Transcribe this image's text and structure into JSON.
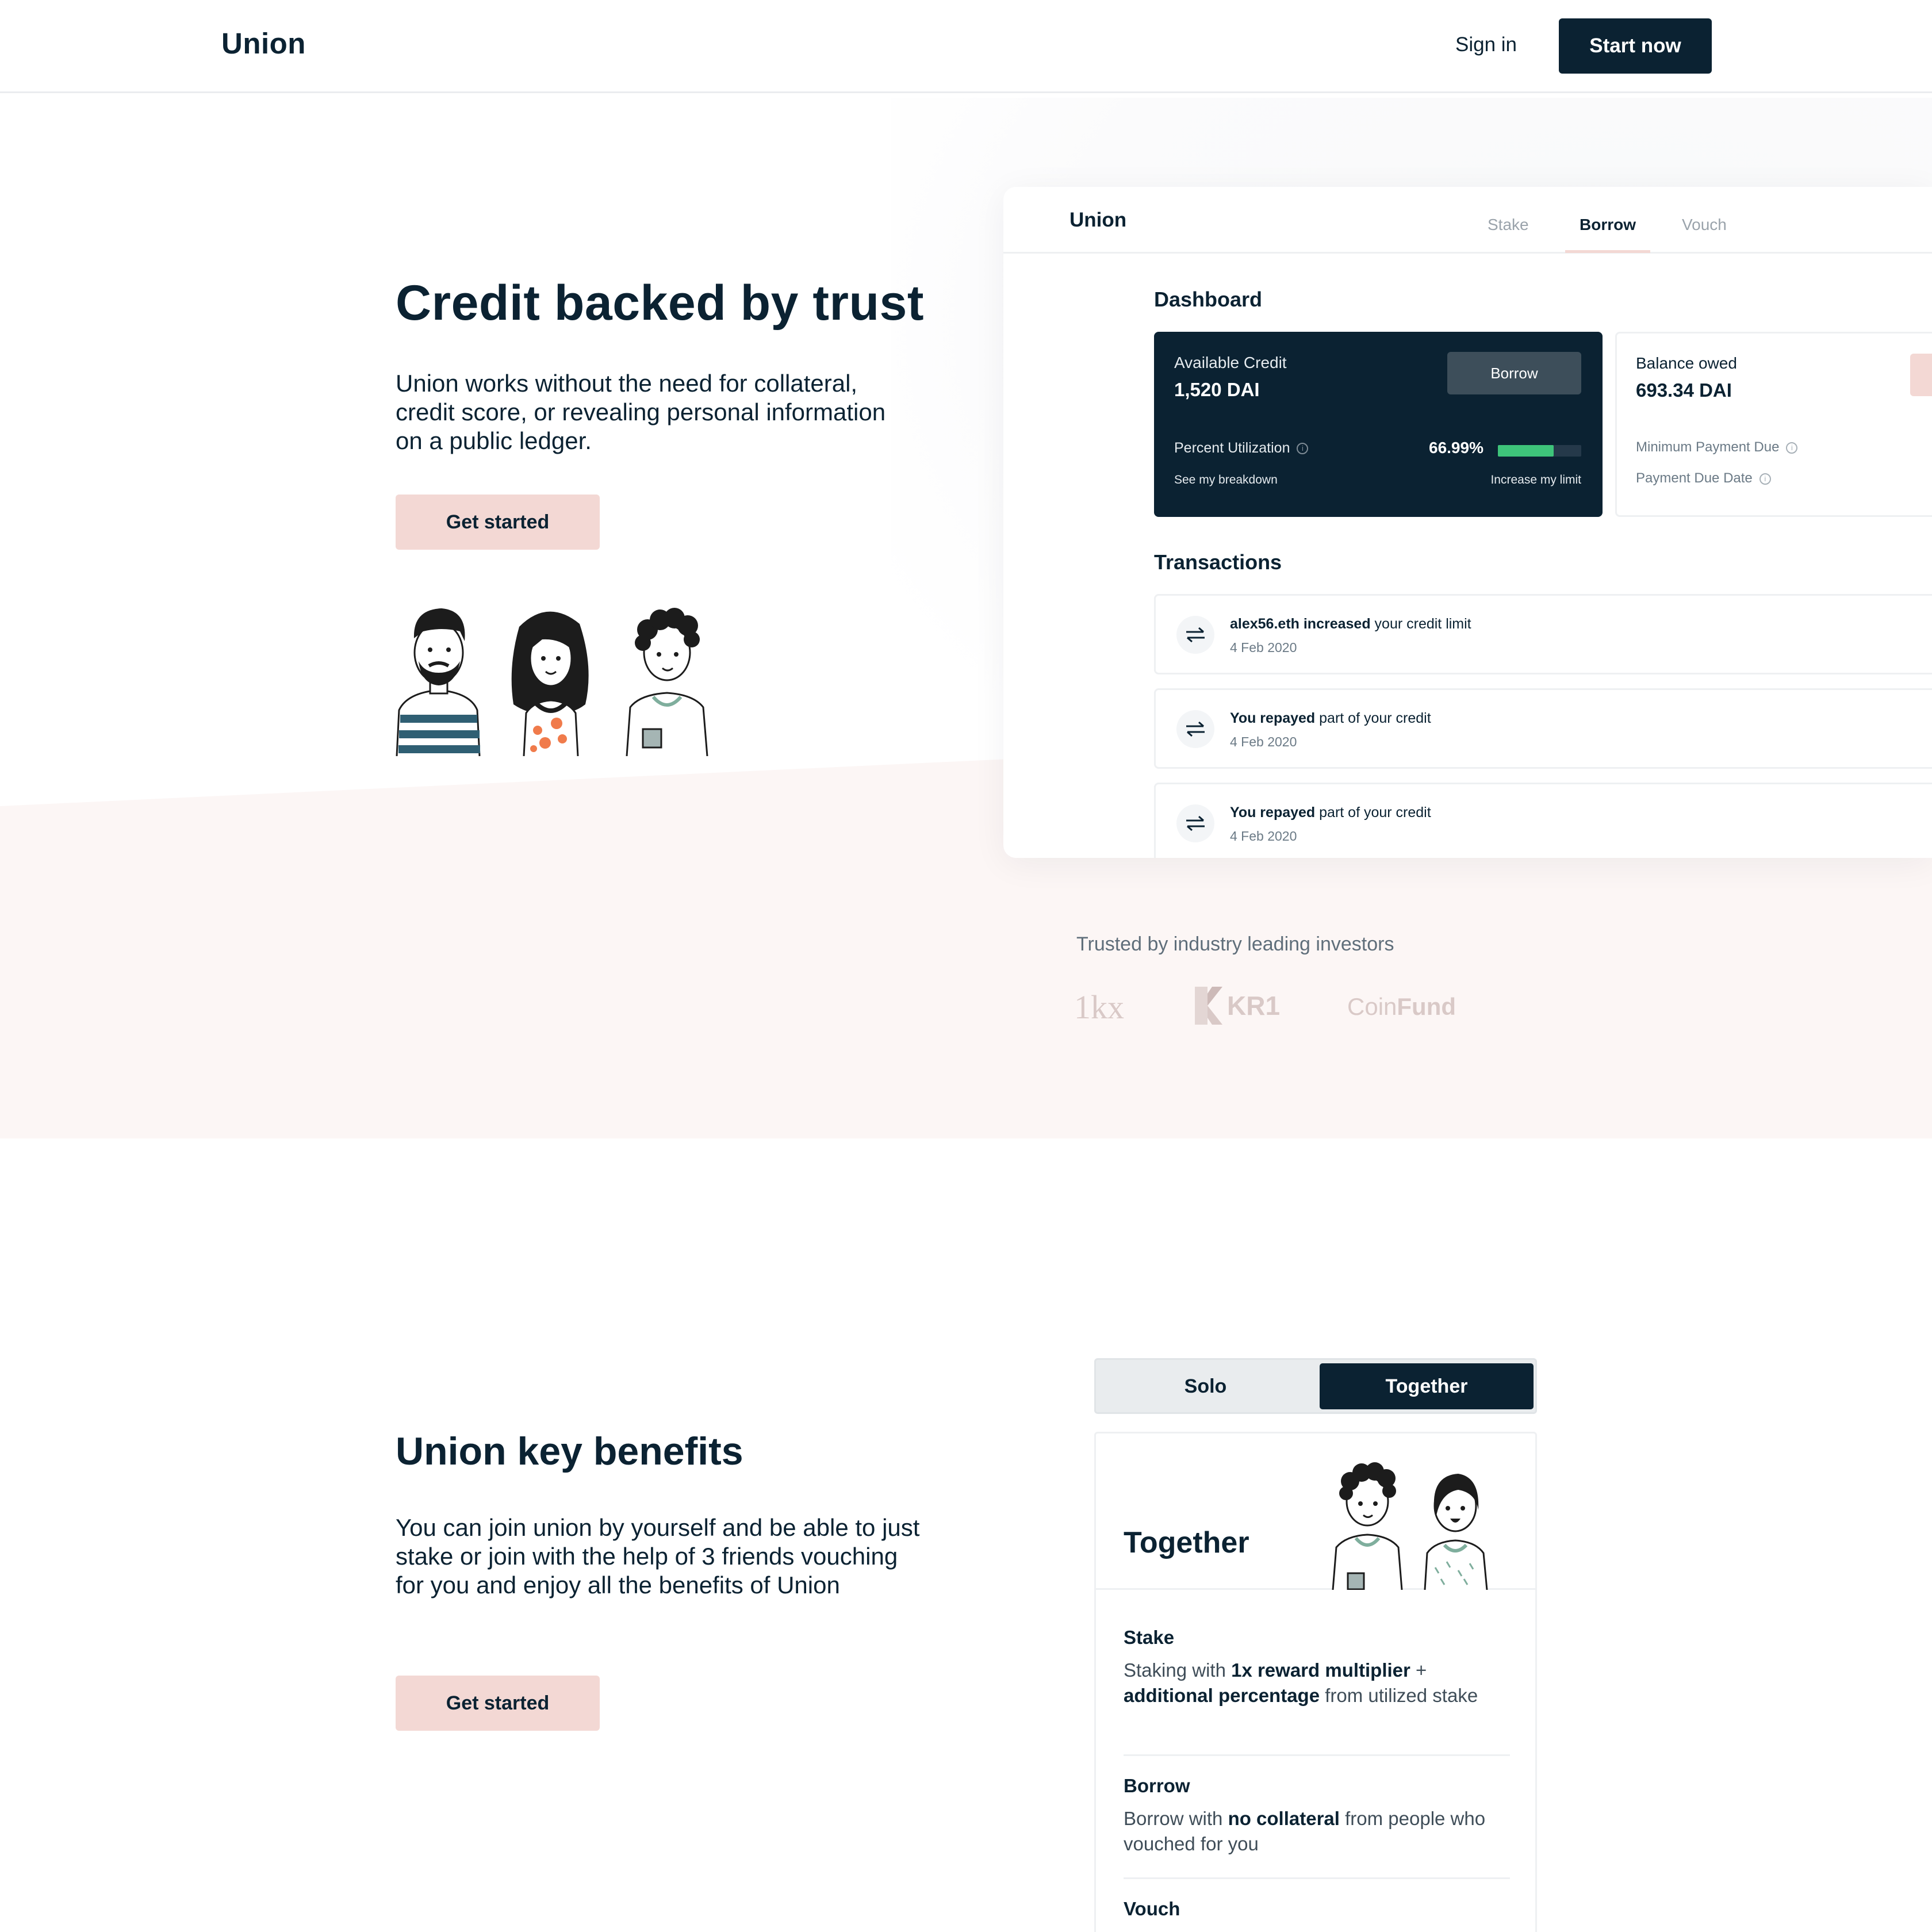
{
  "nav": {
    "logo": "Union",
    "signin": "Sign in",
    "start": "Start now"
  },
  "hero": {
    "title": "Credit backed by trust",
    "subtitle": "Union works without the need for collateral, credit score, or revealing personal information on a public ledger.",
    "cta": "Get started"
  },
  "mock": {
    "logo": "Union",
    "tabs": [
      "Stake",
      "Borrow",
      "Vouch"
    ],
    "active_tab": "Borrow",
    "dashboard_title": "Dashboard",
    "available": {
      "label": "Available Credit",
      "value": "1,520 DAI",
      "button": "Borrow",
      "util_label": "Percent Utilization",
      "util_value": "66.99%",
      "util_fraction": 0.6699,
      "breakdown": "See my breakdown",
      "increase": "Increase my limit"
    },
    "balance": {
      "label": "Balance owed",
      "value": "693.34 DAI",
      "min_payment": "Minimum Payment Due",
      "due_date": "Payment Due Date"
    },
    "transactions_title": "Transactions",
    "transactions": [
      {
        "bold": "alex56.eth increased",
        "rest": " your credit limit",
        "date": "4 Feb 2020"
      },
      {
        "bold": "You repayed",
        "rest": " part of your credit",
        "date": "4 Feb 2020"
      },
      {
        "bold": "You repayed",
        "rest": " part of your credit",
        "date": "4 Feb 2020"
      }
    ]
  },
  "investors": {
    "title": "Trusted by industry leading investors",
    "logos": [
      "1kx",
      "KR1",
      "Coin",
      "Fund"
    ]
  },
  "benefits": {
    "title": "Union key benefits",
    "subtitle": "You can join union by yourself and be able to just stake or join with the help of 3 friends vouching for you and enjoy all the benefits of Union",
    "cta": "Get started",
    "toggle": {
      "solo": "Solo",
      "together": "Together"
    },
    "card": {
      "title": "Together",
      "stake_title": "Stake",
      "stake_text": [
        "Staking with ",
        "1x reward multiplier",
        " + ",
        "additional percentage",
        " from utilized stake"
      ],
      "borrow_title": "Borrow",
      "borrow_text": [
        "Borrow with ",
        "no collateral",
        " from people who vouched for you"
      ],
      "vouch_title": "Vouch"
    }
  },
  "colors": {
    "navy": "#0b2232",
    "pink_button": "#f3d8d4",
    "pink_band": "#fcf6f5",
    "utilization_green": "#3ec47a"
  }
}
